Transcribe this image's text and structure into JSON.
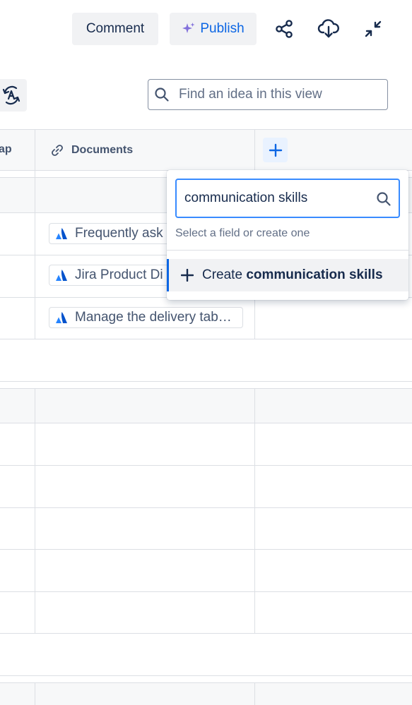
{
  "toolbar": {
    "comment_label": "Comment",
    "publish_label": "Publish",
    "icons": [
      "share-icon",
      "cloud-download-icon",
      "minimize-icon"
    ]
  },
  "view": {
    "sort_icon": "sort-icon",
    "search_placeholder": "Find an idea in this view"
  },
  "table": {
    "columns": [
      {
        "label": "ap",
        "icon": "none"
      },
      {
        "label": "Documents",
        "icon": "link-icon"
      }
    ],
    "rows": [
      {
        "document": "Frequently ask"
      },
      {
        "document": "Jira Product Di"
      },
      {
        "document": "Manage the delivery tab…"
      }
    ]
  },
  "popup": {
    "input_value": "communication skills",
    "hint": "Select a field or create one",
    "create_prefix": "Create",
    "create_term": "communication skills"
  },
  "colors": {
    "accent": "#0c66e4",
    "publish_sparkle": "#8270db",
    "input_focus": "#388bff"
  }
}
